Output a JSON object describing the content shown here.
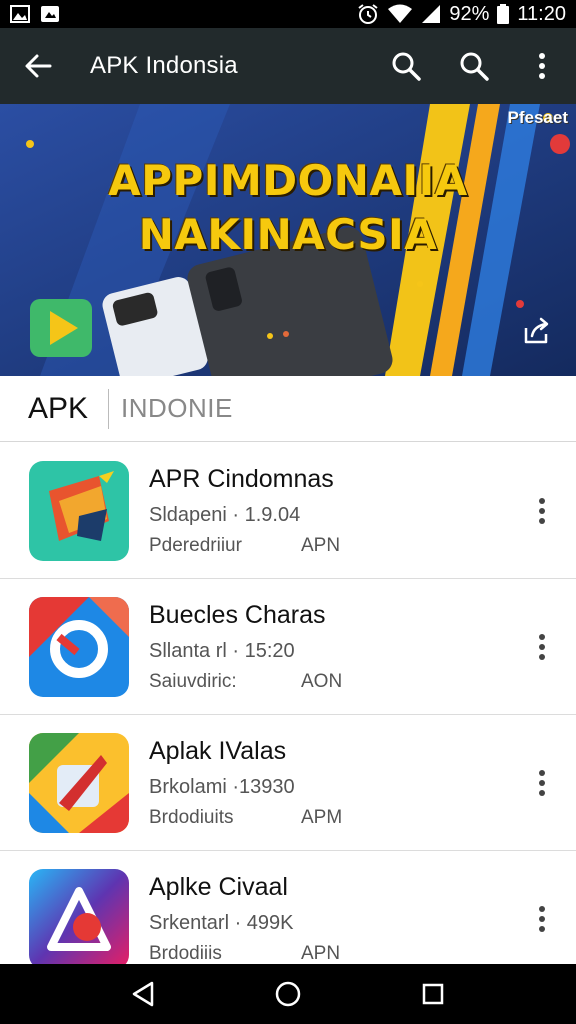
{
  "status_bar": {
    "battery": "92%",
    "time": "11:20",
    "icons": [
      "gallery-icon",
      "android-debug-icon",
      "alarm-icon",
      "wifi-icon",
      "signal-icon",
      "battery-icon"
    ]
  },
  "app_bar": {
    "title": "APK Indonsia",
    "icons": [
      "back-arrow-icon",
      "search-icon",
      "search-icon",
      "more-vert-icon"
    ]
  },
  "banner": {
    "line1": "APPIMDONAIIA",
    "line2": "NAKINACSIA",
    "tag": "Pfesaet"
  },
  "section": {
    "label": "APK",
    "sub": "INDONIE"
  },
  "apps": [
    {
      "name": "APR Cindomnas",
      "meta": "Sldapeni · 1.9.04",
      "category": "Pderedriiur",
      "type": "APN"
    },
    {
      "name": "Buecles Charas",
      "meta": "Sllanta rl · 15:20",
      "category": "Saiuvdiric:",
      "type": "AON"
    },
    {
      "name": "Aplak IValas",
      "meta": "Brkolami ·13930",
      "category": "Brdodiuits",
      "type": "APM"
    },
    {
      "name": "Aplke Civaal",
      "meta": "Srkentarl · 499K",
      "category": "Brdodiiis",
      "type": "APN"
    }
  ],
  "colors": {
    "app_bar": "#222a2c",
    "banner_bg": "#1a3576",
    "banner_text": "#f6c90e"
  }
}
